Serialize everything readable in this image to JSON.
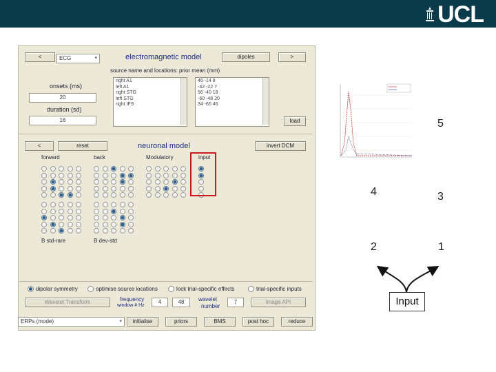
{
  "header": {
    "logo_text": "UCL",
    "bar_color": "#0b3b4a"
  },
  "gui": {
    "top": {
      "prev_label": "<",
      "modality_value": "ECG",
      "model_title": "electromagnetic model",
      "source_type_label": "dipoles",
      "next_label": ">",
      "sources_header": "source name and locations: prior mean (mm)",
      "onsets_label": "onsets (ms)",
      "onsets_value": "20",
      "duration_label": "duration (sd)",
      "duration_value": "16",
      "source_names": [
        "right A1",
        "left A1",
        "right STG",
        "left STG",
        "right IFS"
      ],
      "source_locations": [
        "46 -14   8",
        "-42 -22   7",
        "56 -40  18",
        "-60 -48  20",
        "34 -65  46"
      ],
      "load_label": "load"
    },
    "middle": {
      "back_label": "<",
      "reset_label": "reset",
      "neuronal_title": "neuronal model",
      "invert_label": "invert DCM",
      "col_forward": "forward",
      "col_back": "back",
      "col_modulatory": "Modulatory",
      "col_input": "input",
      "b_label_1": "B std-rare",
      "b_label_2": "B dev-std"
    },
    "options": {
      "dipolar_symmetry": "dipolar symmetry",
      "optimise_locations": "optimise source locations",
      "lock_effects": "lock trial-specific effects",
      "trial_inputs": "trial-specific inputs",
      "wavelet_button": "Wavelet Transform",
      "frequency_label_1": "frequency",
      "frequency_label_2": "window # Hz",
      "freq_low": "4",
      "freq_high": "48",
      "wavelet_label_1": "wavelet",
      "wavelet_label_2": "number",
      "wavelet_value": "7",
      "image_label": "image API"
    },
    "bottom": {
      "analysis_value": "ERPs (mode)",
      "initialise_label": "initialise",
      "priors_label": "priors",
      "bms_label": "BMS",
      "posthoc_label": "post hoc",
      "reduce_label": "reduce"
    }
  },
  "diagram": {
    "nodes": [
      "5",
      "4",
      "3",
      "2",
      "1"
    ],
    "input_label": "Input"
  }
}
